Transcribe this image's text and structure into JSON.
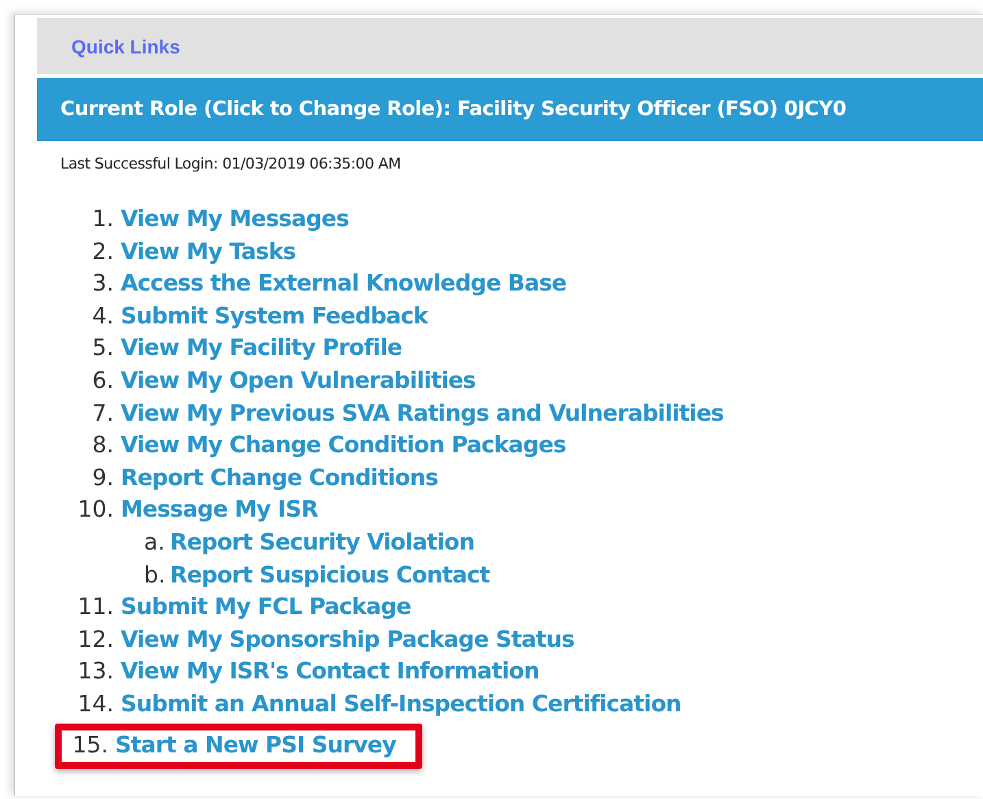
{
  "quick_links": {
    "label": "Quick Links"
  },
  "role_bar": {
    "text": "Current Role (Click to Change Role): Facility Security Officer (FSO) 0JCY0"
  },
  "last_login": "Last Successful Login: 01/03/2019 06:35:00 AM",
  "links": [
    {
      "number": "1.",
      "label": "View My Messages",
      "highlighted": false
    },
    {
      "number": "2.",
      "label": "View My Tasks",
      "highlighted": false
    },
    {
      "number": "3.",
      "label": "Access the External Knowledge Base",
      "highlighted": false
    },
    {
      "number": "4.",
      "label": "Submit System Feedback",
      "highlighted": false
    },
    {
      "number": "5.",
      "label": "View My Facility Profile",
      "highlighted": false
    },
    {
      "number": "6.",
      "label": "View My Open Vulnerabilities",
      "highlighted": false
    },
    {
      "number": "7.",
      "label": "View My Previous SVA Ratings and Vulnerabilities",
      "highlighted": false
    },
    {
      "number": "8.",
      "label": "View My Change Condition Packages",
      "highlighted": false
    },
    {
      "number": "9.",
      "label": "Report Change Conditions",
      "highlighted": false
    },
    {
      "number": "10.",
      "label": "Message My ISR",
      "highlighted": false,
      "children": [
        {
          "number": "a.",
          "label": "Report Security Violation",
          "highlighted": false
        },
        {
          "number": "b.",
          "label": "Report Suspicious Contact",
          "highlighted": false
        }
      ]
    },
    {
      "number": "11.",
      "label": "Submit My FCL Package",
      "highlighted": false
    },
    {
      "number": "12.",
      "label": "View My Sponsorship Package Status",
      "highlighted": false
    },
    {
      "number": "13.",
      "label": "View My ISR's Contact Information",
      "highlighted": false
    },
    {
      "number": "14.",
      "label": "Submit an Annual Self-Inspection Certification",
      "highlighted": false
    },
    {
      "number": "15.",
      "label": "Start a New PSI Survey",
      "highlighted": true
    }
  ]
}
